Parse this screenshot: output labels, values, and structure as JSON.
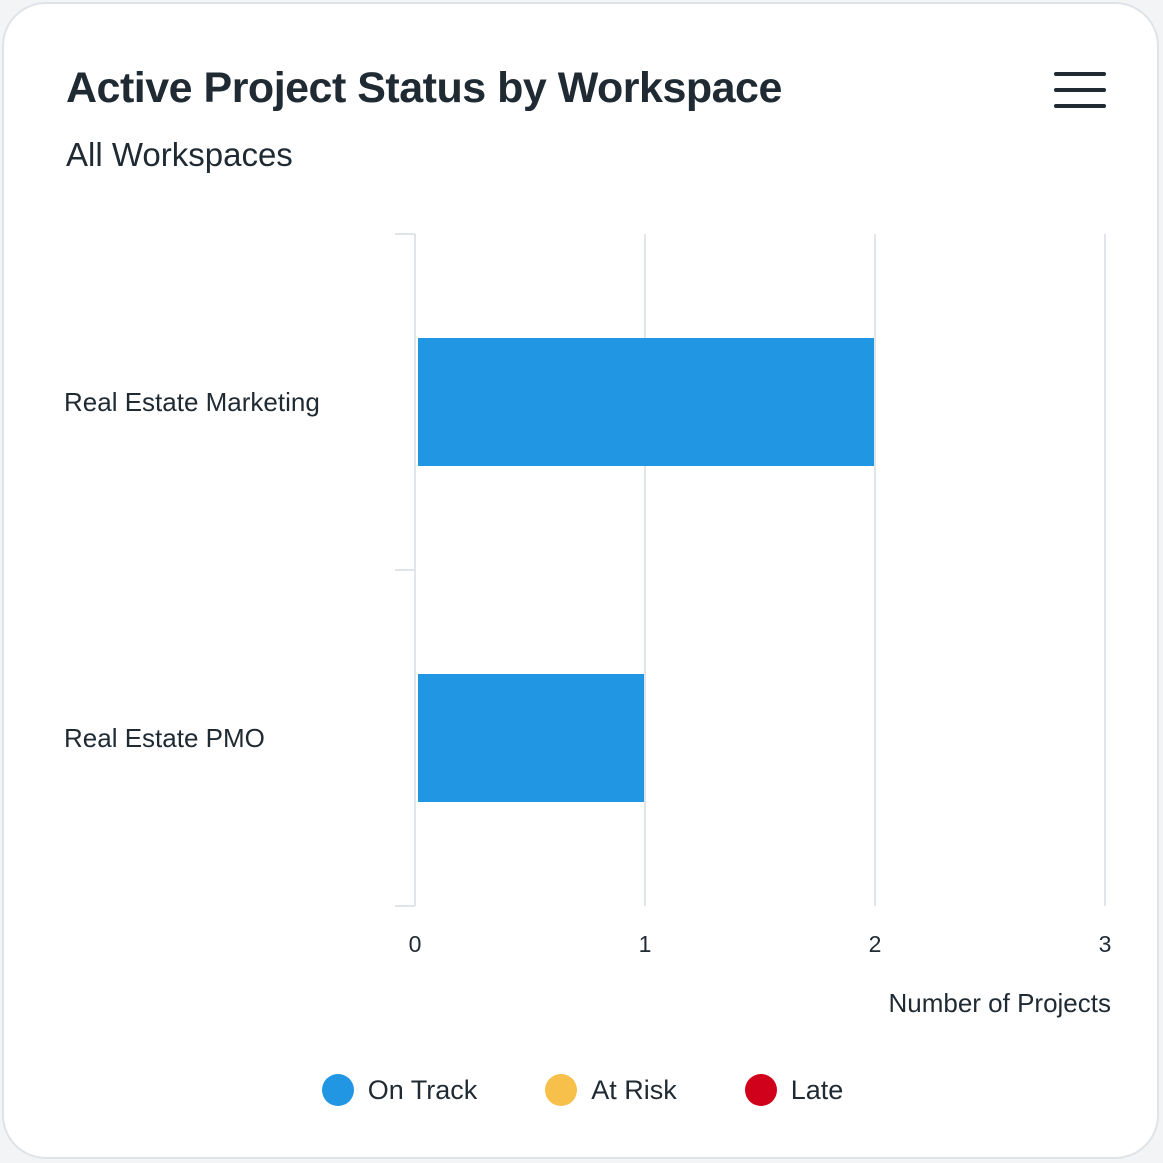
{
  "header": {
    "title": "Active Project Status by Workspace",
    "subtitle": "All Workspaces",
    "menu_icon": "hamburger-menu-icon"
  },
  "colors": {
    "on_track": "#2196e3",
    "at_risk": "#f7c04a",
    "late": "#d0021b",
    "text": "#1f2a33",
    "grid": "#e1e4e8"
  },
  "chart_data": {
    "type": "bar",
    "orientation": "horizontal",
    "stacked": true,
    "categories": [
      "Real Estate Marketing",
      "Real Estate PMO"
    ],
    "series": [
      {
        "name": "On Track",
        "values": [
          2,
          1
        ],
        "color": "#2196e3"
      },
      {
        "name": "At Risk",
        "values": [
          0,
          0
        ],
        "color": "#f7c04a"
      },
      {
        "name": "Late",
        "values": [
          0,
          0
        ],
        "color": "#d0021b"
      }
    ],
    "title": "Active Project Status by Workspace",
    "subtitle": "All Workspaces",
    "xlabel": "Number of Projects",
    "ylabel": "",
    "xlim": [
      0,
      3
    ],
    "xticks": [
      "0",
      "1",
      "2",
      "3"
    ],
    "grid": true,
    "legend_position": "bottom"
  }
}
